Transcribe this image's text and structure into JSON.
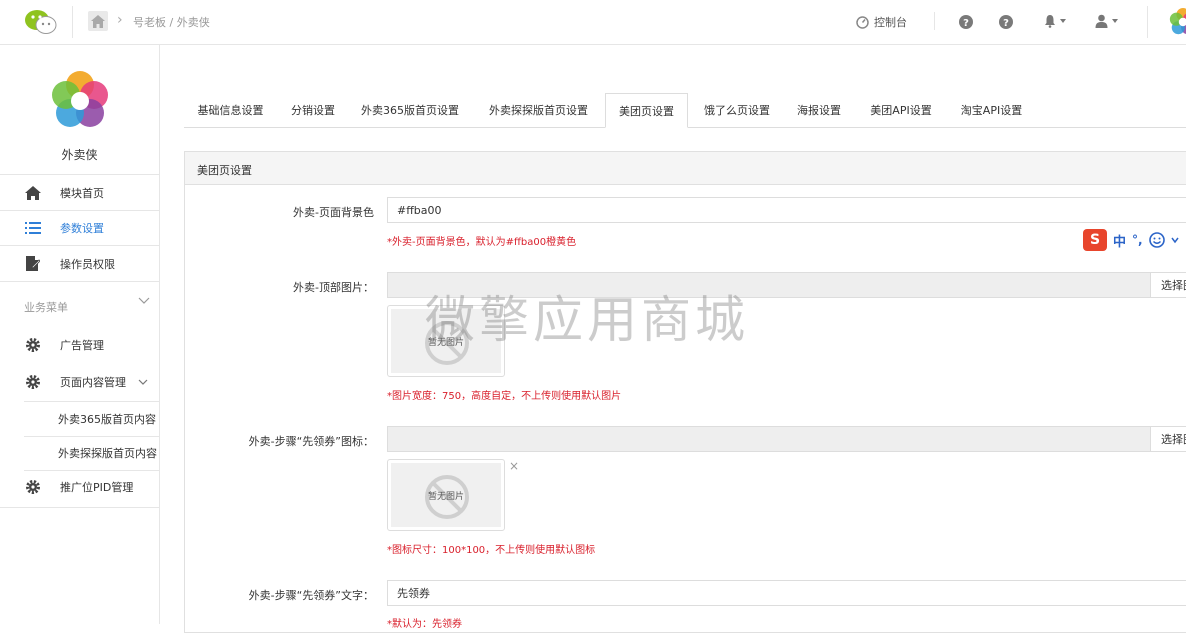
{
  "topbar": {
    "breadcrumb": "号老板 / 外卖侠",
    "console_label": "控制台"
  },
  "sidebar": {
    "app_name": "外卖侠",
    "items": [
      {
        "label": "模块首页"
      },
      {
        "label": "参数设置"
      },
      {
        "label": "操作员权限"
      }
    ],
    "section_title": "业务菜单",
    "menu": [
      {
        "label": "广告管理"
      },
      {
        "label": "页面内容管理"
      }
    ],
    "sub_items": [
      {
        "label": "外卖365版首页内容"
      },
      {
        "label": "外卖探探版首页内容"
      }
    ],
    "pid_label": "推广位PID管理"
  },
  "tabs": [
    {
      "label": "基础信息设置"
    },
    {
      "label": "分销设置"
    },
    {
      "label": "外卖365版首页设置"
    },
    {
      "label": "外卖探探版首页设置"
    },
    {
      "label": "美团页设置"
    },
    {
      "label": "饿了么页设置"
    },
    {
      "label": "海报设置"
    },
    {
      "label": "美团API设置"
    },
    {
      "label": "淘宝API设置"
    }
  ],
  "panel": {
    "title": "美团页设置",
    "fields": [
      {
        "label": "外卖-页面背景色",
        "value": "#ffba00",
        "hint": "*外卖-页面背景色，默认为#ffba00橙黄色"
      },
      {
        "label": "外卖-顶部图片：",
        "button": "选择图片",
        "image_text": "暂无图片",
        "hint": "*图片宽度：750，高度自定，不上传则使用默认图片"
      },
      {
        "label": "外卖-步骤“先领券”图标：",
        "button": "选择图片",
        "image_text": "暂无图片",
        "close": "×",
        "hint": "*图标尺寸：100*100，不上传则使用默认图标"
      },
      {
        "label": "外卖-步骤“先领券”文字：",
        "value": "先领券",
        "hint": "*默认为：先领券"
      }
    ]
  },
  "watermark": "微擎应用商城",
  "ime": {
    "logo": "S",
    "lang": "中",
    "punct": "°,"
  },
  "colors": {
    "accent": "#2f7fd8",
    "hint": "#d9202c"
  }
}
